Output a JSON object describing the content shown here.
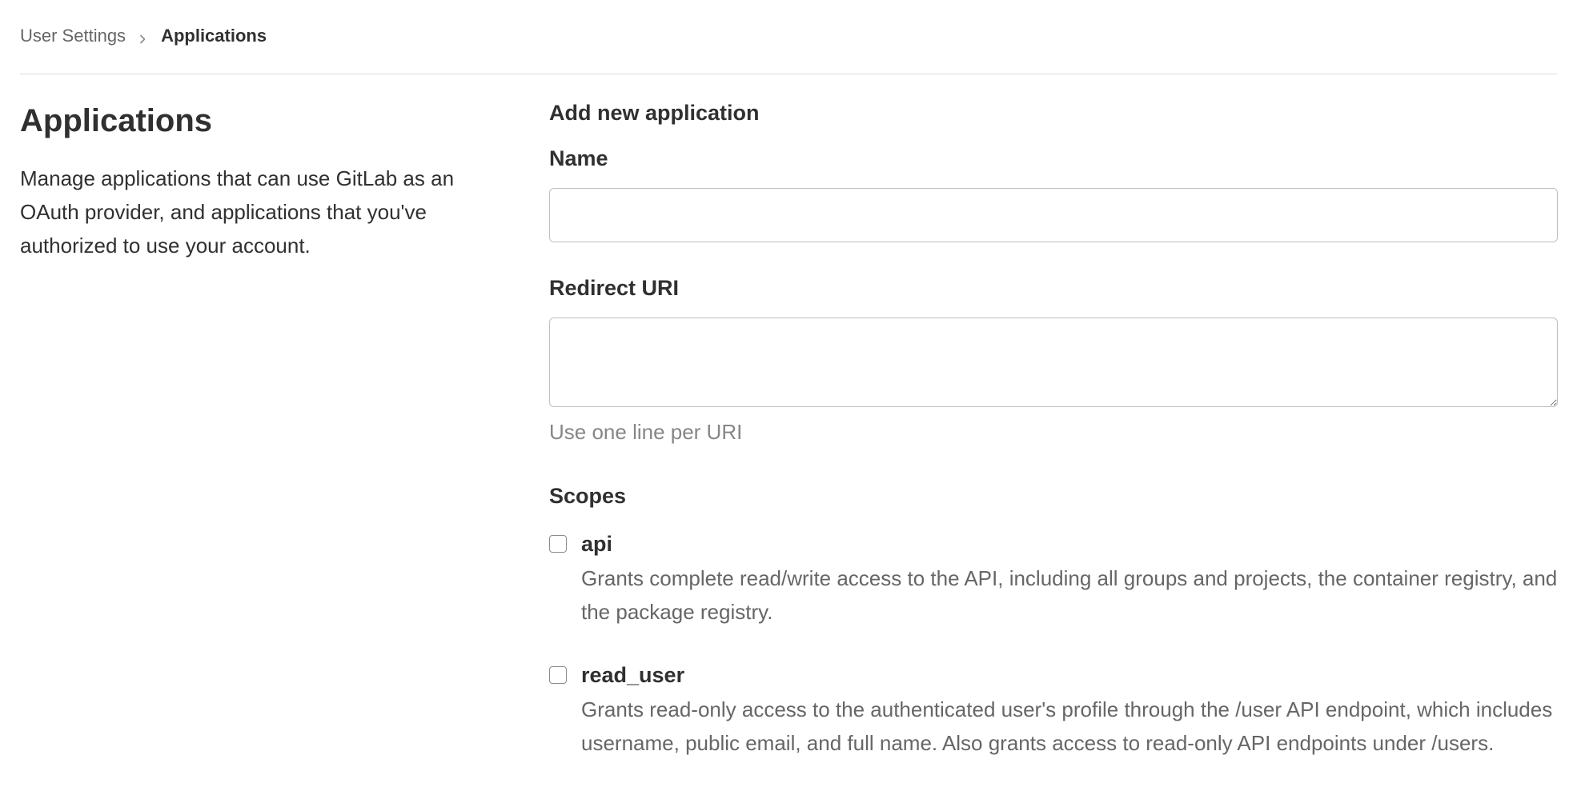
{
  "breadcrumb": {
    "parent": "User Settings",
    "current": "Applications",
    "separator_icon": "chevron-right-icon"
  },
  "colors": {
    "text_primary": "#303030",
    "text_muted": "#666666",
    "text_help": "#868686",
    "border": "#bfbfbf",
    "divider": "#dbdbdb"
  },
  "sidebar": {
    "title": "Applications",
    "description": "Manage applications that can use GitLab as an OAuth provider, and applications that you've authorized to use your account."
  },
  "form": {
    "heading": "Add new application",
    "name_label": "Name",
    "name_value": "",
    "redirect_label": "Redirect URI",
    "redirect_value": "",
    "redirect_help": "Use one line per URI",
    "scopes_label": "Scopes",
    "scopes": [
      {
        "name": "api",
        "checked": false,
        "description": "Grants complete read/write access to the API, including all groups and projects, the container registry, and the package registry."
      },
      {
        "name": "read_user",
        "checked": false,
        "description": "Grants read-only access to the authenticated user's profile through the /user API endpoint, which includes username, public email, and full name. Also grants access to read-only API endpoints under /users."
      }
    ]
  }
}
